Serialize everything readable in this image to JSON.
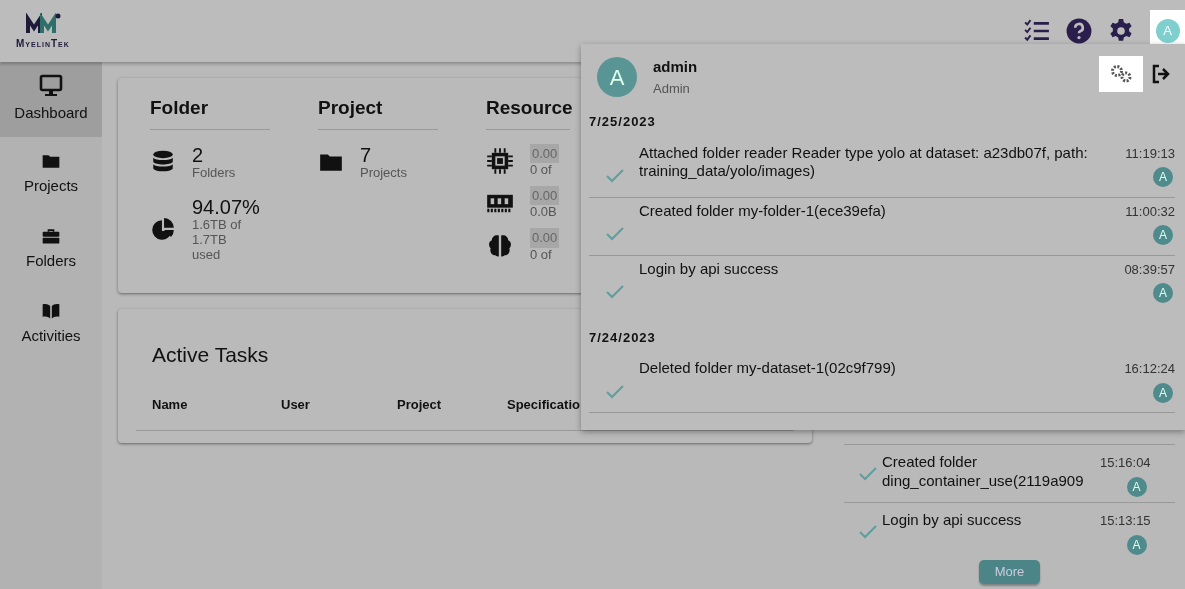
{
  "header": {
    "logo": "MyelinTek",
    "avatar": "A"
  },
  "sidebar": {
    "items": [
      {
        "label": "Dashboard",
        "selected": true
      },
      {
        "label": "Projects",
        "selected": false
      },
      {
        "label": "Folders",
        "selected": false
      },
      {
        "label": "Activities",
        "selected": false
      }
    ]
  },
  "summary": {
    "sections": [
      {
        "title": "Folder",
        "stats": [
          {
            "value": "2",
            "label": "Folders"
          },
          {
            "value": "94.07%",
            "label": "1.6TB of 1.7TB used"
          }
        ]
      },
      {
        "title": "Project",
        "stats": [
          {
            "value": "7",
            "label": "Projects"
          }
        ]
      },
      {
        "title": "Resource",
        "stats": [
          {
            "value": "0.00",
            "label": "0 of"
          },
          {
            "value": "0.00",
            "label": "0.0B"
          },
          {
            "value": "0.00",
            "label": "0 of"
          }
        ]
      }
    ]
  },
  "active_tasks": {
    "title": "Active Tasks",
    "columns": [
      "Name",
      "User",
      "Project",
      "Specificatio"
    ]
  },
  "timeline": {
    "items": [
      {
        "text": "Created folder ding_container_use(2119a909",
        "time": "15:16:04",
        "user": "A",
        "done": true
      },
      {
        "text": "Login by api success",
        "time": "15:13:15",
        "user": "A",
        "done": true
      }
    ],
    "more_button": "More"
  },
  "user_menu": {
    "name": "admin",
    "role": "Admin",
    "avatar": "A",
    "groups": [
      {
        "date": "7/25/2023",
        "items": [
          {
            "text": "Attached folder reader Reader type yolo at dataset: a23db07f, path: training_data/yolo/images)",
            "time": "11:19:13",
            "user": "A",
            "done": true
          },
          {
            "text": "Created folder my-folder-1(ece39efa)",
            "time": "11:00:32",
            "user": "A",
            "done": true
          },
          {
            "text": "Login by api success",
            "time": "08:39:57",
            "user": "A",
            "done": true
          }
        ]
      },
      {
        "date": "7/24/2023",
        "items": [
          {
            "text": "Deleted folder my-dataset-1(02c9f799)",
            "time": "16:12:24",
            "user": "A",
            "done": true
          }
        ]
      }
    ]
  }
}
